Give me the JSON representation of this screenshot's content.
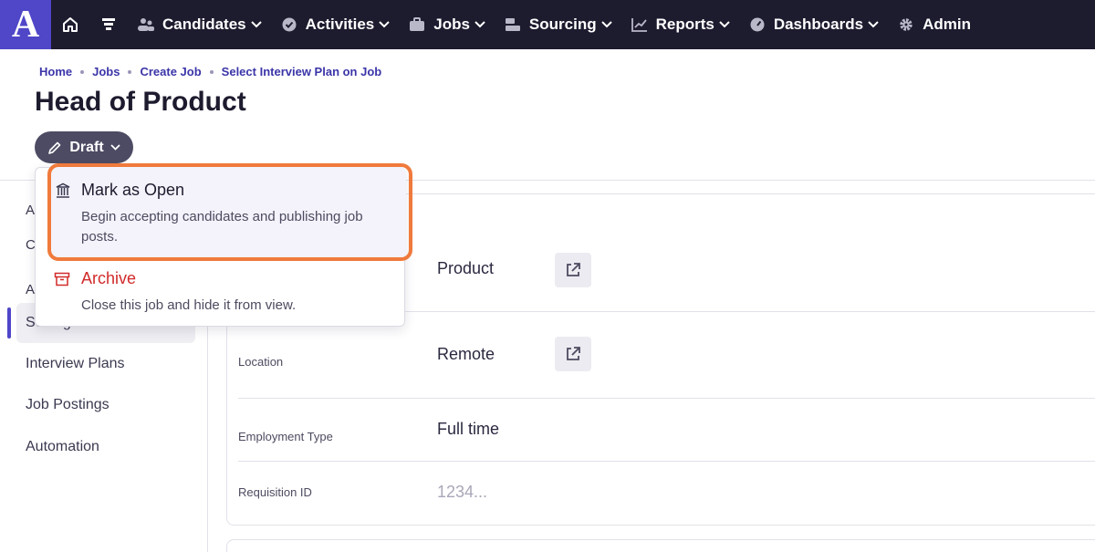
{
  "brand": {
    "logo_letter": "A",
    "logo_color": "#4f46c8",
    "nav_bg": "#1d1b2e"
  },
  "nav": {
    "home_icon": "home-icon",
    "filter_icon": "funnel-icon",
    "items": [
      {
        "label": "Candidates",
        "icon": "people-icon"
      },
      {
        "label": "Activities",
        "icon": "check-circle-icon"
      },
      {
        "label": "Jobs",
        "icon": "briefcase-icon"
      },
      {
        "label": "Sourcing",
        "icon": "sourcing-icon"
      },
      {
        "label": "Reports",
        "icon": "chart-line-icon"
      },
      {
        "label": "Dashboards",
        "icon": "gauge-icon"
      },
      {
        "label": "Admin",
        "icon": "gear-icon"
      }
    ]
  },
  "breadcrumb": [
    "Home",
    "Jobs",
    "Create Job",
    "Select Interview Plan on Job"
  ],
  "page": {
    "title": "Head of Product",
    "status_label": "Draft"
  },
  "dropdown": {
    "open": {
      "title": "Mark as Open",
      "description": "Begin accepting candidates and publishing job posts.",
      "icon": "building-columns-icon"
    },
    "archive": {
      "title": "Archive",
      "description": "Close this job and hide it from view.",
      "icon": "archive-box-icon",
      "color": "#d22a2a"
    },
    "highlight_color": "#f07a3c"
  },
  "sidebar": {
    "partial_letters": [
      "A",
      "C",
      "A"
    ],
    "active_label": "Settings",
    "items": [
      "Interview Plans",
      "Job Postings",
      "Automation"
    ]
  },
  "fields": [
    {
      "label": "",
      "value": "Product",
      "has_link": true
    },
    {
      "label": "Location",
      "value": "Remote",
      "has_link": true
    },
    {
      "label": "Employment Type",
      "value": "Full time",
      "has_link": false
    },
    {
      "label": "Requisition ID",
      "value": "1234...",
      "has_link": false
    }
  ]
}
